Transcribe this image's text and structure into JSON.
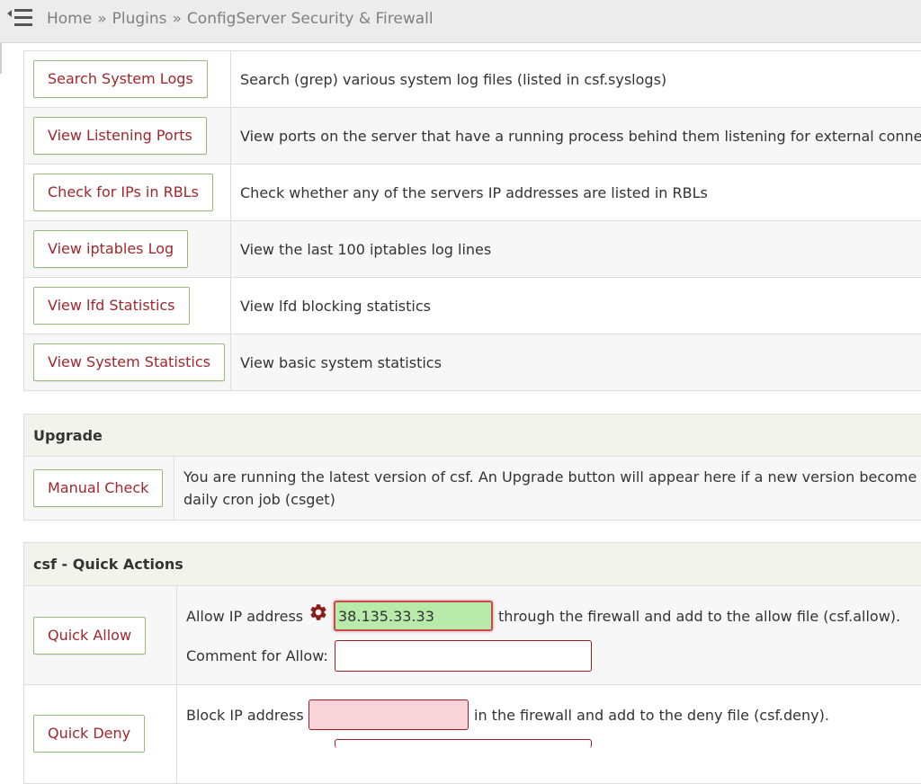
{
  "breadcrumb": {
    "home": "Home",
    "plugins": "Plugins",
    "current": "ConfigServer Security & Firewall",
    "separator": "»"
  },
  "tools": [
    {
      "button": "Search System Logs",
      "description": "Search (grep) various system log files (listed in csf.syslogs)"
    },
    {
      "button": "View Listening Ports",
      "description": "View ports on the server that have a running process behind them listening for external conne"
    },
    {
      "button": "Check for IPs in RBLs",
      "description": "Check whether any of the servers IP addresses are listed in RBLs"
    },
    {
      "button": "View iptables Log",
      "description": "View the last 100 iptables log lines"
    },
    {
      "button": "View lfd Statistics",
      "description": "View lfd blocking statistics"
    },
    {
      "button": "View System Statistics",
      "description": "View basic system statistics"
    }
  ],
  "upgrade": {
    "title": "Upgrade",
    "button": "Manual Check",
    "text_line1": "You are running the latest version of csf. An Upgrade button will appear here if a new version become",
    "text_line2": "daily cron job (csget)"
  },
  "quick_actions": {
    "title": "csf - Quick Actions",
    "allow": {
      "button": "Quick Allow",
      "label": "Allow IP address",
      "ip_value": "38.135.33.33",
      "suffix": "through the firewall and add to the allow file (csf.allow).",
      "comment_label": "Comment for Allow:",
      "comment_value": ""
    },
    "deny": {
      "button": "Quick Deny",
      "label": "Block IP address",
      "ip_value": "",
      "suffix": "in the firewall and add to the deny file (csf.deny)."
    }
  },
  "colors": {
    "button_text": "#a0282c",
    "button_border": "#96bb7c",
    "input_valid_bg": "#b8eaa9",
    "input_invalid_bg": "#f9d3da",
    "input_border": "#9b1c22"
  }
}
